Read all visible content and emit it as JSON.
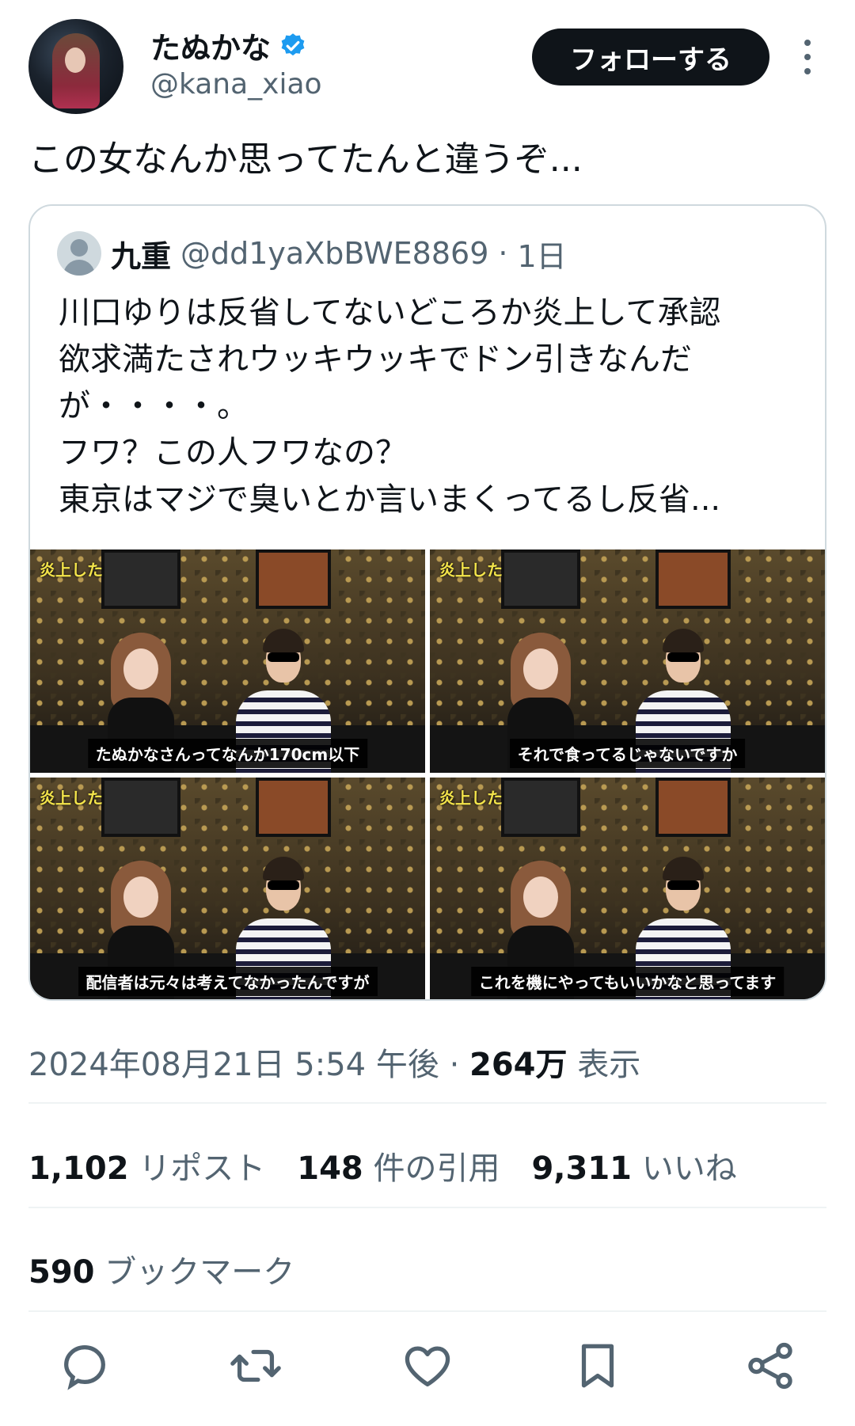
{
  "author": {
    "display_name": "たぬかな",
    "handle": "@kana_xiao",
    "verified": true,
    "follow_label": "フォローする"
  },
  "tweet": {
    "text": "この女なんか思ってたんと違うぞ..."
  },
  "quote": {
    "name": "九重",
    "handle": "@dd1yaXbBWE8869",
    "separator": "·",
    "time": "1日",
    "lines": [
      "川口ゆりは反省してないどころか炎上して承認",
      "欲求満たされウッキウッキでドン引きなんだ",
      "が・・・・。",
      "フワ？この人フワなの？",
      "東京はマジで臭いとか言いまくってるし反省..."
    ],
    "media": [
      {
        "tag": "炎上した",
        "caption": "たぬかなさんってなんか170cm以下"
      },
      {
        "tag": "炎上した",
        "caption": "それで食ってるじゃないですか"
      },
      {
        "tag": "炎上した",
        "caption": "配信者は元々は考えてなかったんですが"
      },
      {
        "tag": "炎上した",
        "caption": "これを機にやってもいいかなと思ってます"
      }
    ]
  },
  "meta": {
    "datetime": "2024年08月21日 5:54 午後",
    "separator": "·",
    "views_count": "264万",
    "views_label": "表示"
  },
  "stats": {
    "reposts": {
      "count": "1,102",
      "label": "リポスト"
    },
    "quotes": {
      "count": "148",
      "label": "件の引用"
    },
    "likes": {
      "count": "9,311",
      "label": "いいね"
    },
    "bookmarks": {
      "count": "590",
      "label": "ブックマーク"
    }
  },
  "actions": [
    "reply-icon",
    "repost-icon",
    "like-icon",
    "bookmark-icon",
    "share-icon"
  ],
  "colors": {
    "text": "#0f1419",
    "secondary": "#536471",
    "border": "#cfd9de",
    "verified": "#1d9bf0",
    "button_bg": "#0f1419"
  }
}
